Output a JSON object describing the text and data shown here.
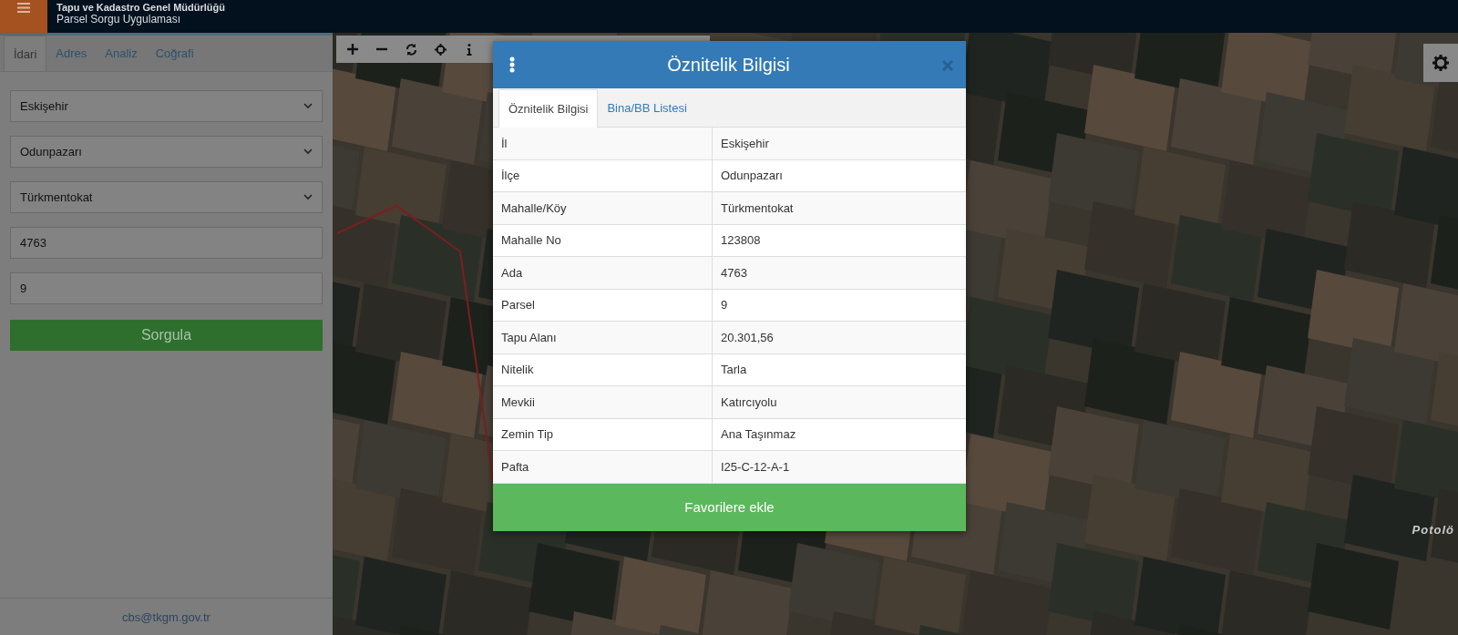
{
  "header": {
    "title_line_1": "Tapu ve Kadastro Genel Müdürlüğü",
    "title_line_2": "Parsel Sorgu Uygulaması"
  },
  "side_panel": {
    "tabs": [
      {
        "label": "İdari",
        "selected": true
      },
      {
        "label": "Adres",
        "selected": false
      },
      {
        "label": "Analiz",
        "selected": false
      },
      {
        "label": "Coğrafi",
        "selected": false
      }
    ],
    "fields": [
      {
        "kind": "select",
        "value": "Eskişehir"
      },
      {
        "kind": "select",
        "value": "Odunpazarı"
      },
      {
        "kind": "select",
        "value": "Türkmentokat"
      },
      {
        "kind": "input",
        "value": "4763"
      },
      {
        "kind": "input",
        "value": "9"
      }
    ],
    "button": "Sorgula",
    "footer_email": "cbs@tkgm.gov.tr"
  },
  "map": {
    "place_label": "Potolö"
  },
  "modal": {
    "title": "Öznitelik Bilgisi",
    "tabs": [
      {
        "label": "Öznitelik Bilgisi",
        "selected": true
      },
      {
        "label": "Bina/BB Listesi",
        "selected": false
      }
    ],
    "rows": [
      {
        "label": "İl",
        "value": "Eskişehir"
      },
      {
        "label": "İlçe",
        "value": "Odunpazarı"
      },
      {
        "label": "Mahalle/Köy",
        "value": "Türkmentokat"
      },
      {
        "label": "Mahalle No",
        "value": "123808"
      },
      {
        "label": "Ada",
        "value": "4763"
      },
      {
        "label": "Parsel",
        "value": "9"
      },
      {
        "label": "Tapu Alanı",
        "value": "20.301,56"
      },
      {
        "label": "Nitelik",
        "value": "Tarla"
      },
      {
        "label": "Mevkii",
        "value": "Katırcıyolu"
      },
      {
        "label": "Zemin Tip",
        "value": "Ana Taşınmaz"
      },
      {
        "label": "Pafta",
        "value": "I25-C-12-A-1"
      }
    ],
    "button": "Favorilere ekle"
  }
}
